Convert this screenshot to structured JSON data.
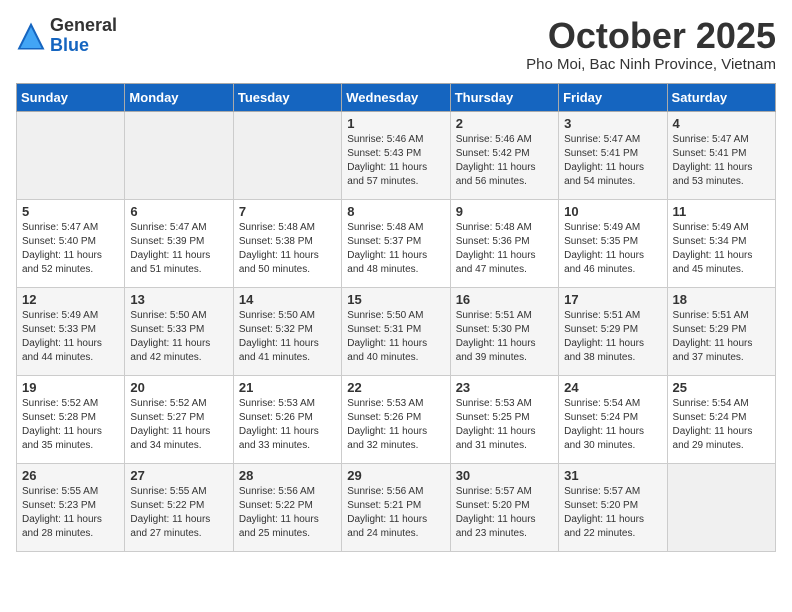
{
  "header": {
    "logo_general": "General",
    "logo_blue": "Blue",
    "month_title": "October 2025",
    "location": "Pho Moi, Bac Ninh Province, Vietnam"
  },
  "days_of_week": [
    "Sunday",
    "Monday",
    "Tuesday",
    "Wednesday",
    "Thursday",
    "Friday",
    "Saturday"
  ],
  "weeks": [
    [
      {
        "day": "",
        "info": ""
      },
      {
        "day": "",
        "info": ""
      },
      {
        "day": "",
        "info": ""
      },
      {
        "day": "1",
        "info": "Sunrise: 5:46 AM\nSunset: 5:43 PM\nDaylight: 11 hours and 57 minutes."
      },
      {
        "day": "2",
        "info": "Sunrise: 5:46 AM\nSunset: 5:42 PM\nDaylight: 11 hours and 56 minutes."
      },
      {
        "day": "3",
        "info": "Sunrise: 5:47 AM\nSunset: 5:41 PM\nDaylight: 11 hours and 54 minutes."
      },
      {
        "day": "4",
        "info": "Sunrise: 5:47 AM\nSunset: 5:41 PM\nDaylight: 11 hours and 53 minutes."
      }
    ],
    [
      {
        "day": "5",
        "info": "Sunrise: 5:47 AM\nSunset: 5:40 PM\nDaylight: 11 hours and 52 minutes."
      },
      {
        "day": "6",
        "info": "Sunrise: 5:47 AM\nSunset: 5:39 PM\nDaylight: 11 hours and 51 minutes."
      },
      {
        "day": "7",
        "info": "Sunrise: 5:48 AM\nSunset: 5:38 PM\nDaylight: 11 hours and 50 minutes."
      },
      {
        "day": "8",
        "info": "Sunrise: 5:48 AM\nSunset: 5:37 PM\nDaylight: 11 hours and 48 minutes."
      },
      {
        "day": "9",
        "info": "Sunrise: 5:48 AM\nSunset: 5:36 PM\nDaylight: 11 hours and 47 minutes."
      },
      {
        "day": "10",
        "info": "Sunrise: 5:49 AM\nSunset: 5:35 PM\nDaylight: 11 hours and 46 minutes."
      },
      {
        "day": "11",
        "info": "Sunrise: 5:49 AM\nSunset: 5:34 PM\nDaylight: 11 hours and 45 minutes."
      }
    ],
    [
      {
        "day": "12",
        "info": "Sunrise: 5:49 AM\nSunset: 5:33 PM\nDaylight: 11 hours and 44 minutes."
      },
      {
        "day": "13",
        "info": "Sunrise: 5:50 AM\nSunset: 5:33 PM\nDaylight: 11 hours and 42 minutes."
      },
      {
        "day": "14",
        "info": "Sunrise: 5:50 AM\nSunset: 5:32 PM\nDaylight: 11 hours and 41 minutes."
      },
      {
        "day": "15",
        "info": "Sunrise: 5:50 AM\nSunset: 5:31 PM\nDaylight: 11 hours and 40 minutes."
      },
      {
        "day": "16",
        "info": "Sunrise: 5:51 AM\nSunset: 5:30 PM\nDaylight: 11 hours and 39 minutes."
      },
      {
        "day": "17",
        "info": "Sunrise: 5:51 AM\nSunset: 5:29 PM\nDaylight: 11 hours and 38 minutes."
      },
      {
        "day": "18",
        "info": "Sunrise: 5:51 AM\nSunset: 5:29 PM\nDaylight: 11 hours and 37 minutes."
      }
    ],
    [
      {
        "day": "19",
        "info": "Sunrise: 5:52 AM\nSunset: 5:28 PM\nDaylight: 11 hours and 35 minutes."
      },
      {
        "day": "20",
        "info": "Sunrise: 5:52 AM\nSunset: 5:27 PM\nDaylight: 11 hours and 34 minutes."
      },
      {
        "day": "21",
        "info": "Sunrise: 5:53 AM\nSunset: 5:26 PM\nDaylight: 11 hours and 33 minutes."
      },
      {
        "day": "22",
        "info": "Sunrise: 5:53 AM\nSunset: 5:26 PM\nDaylight: 11 hours and 32 minutes."
      },
      {
        "day": "23",
        "info": "Sunrise: 5:53 AM\nSunset: 5:25 PM\nDaylight: 11 hours and 31 minutes."
      },
      {
        "day": "24",
        "info": "Sunrise: 5:54 AM\nSunset: 5:24 PM\nDaylight: 11 hours and 30 minutes."
      },
      {
        "day": "25",
        "info": "Sunrise: 5:54 AM\nSunset: 5:24 PM\nDaylight: 11 hours and 29 minutes."
      }
    ],
    [
      {
        "day": "26",
        "info": "Sunrise: 5:55 AM\nSunset: 5:23 PM\nDaylight: 11 hours and 28 minutes."
      },
      {
        "day": "27",
        "info": "Sunrise: 5:55 AM\nSunset: 5:22 PM\nDaylight: 11 hours and 27 minutes."
      },
      {
        "day": "28",
        "info": "Sunrise: 5:56 AM\nSunset: 5:22 PM\nDaylight: 11 hours and 25 minutes."
      },
      {
        "day": "29",
        "info": "Sunrise: 5:56 AM\nSunset: 5:21 PM\nDaylight: 11 hours and 24 minutes."
      },
      {
        "day": "30",
        "info": "Sunrise: 5:57 AM\nSunset: 5:20 PM\nDaylight: 11 hours and 23 minutes."
      },
      {
        "day": "31",
        "info": "Sunrise: 5:57 AM\nSunset: 5:20 PM\nDaylight: 11 hours and 22 minutes."
      },
      {
        "day": "",
        "info": ""
      }
    ]
  ]
}
